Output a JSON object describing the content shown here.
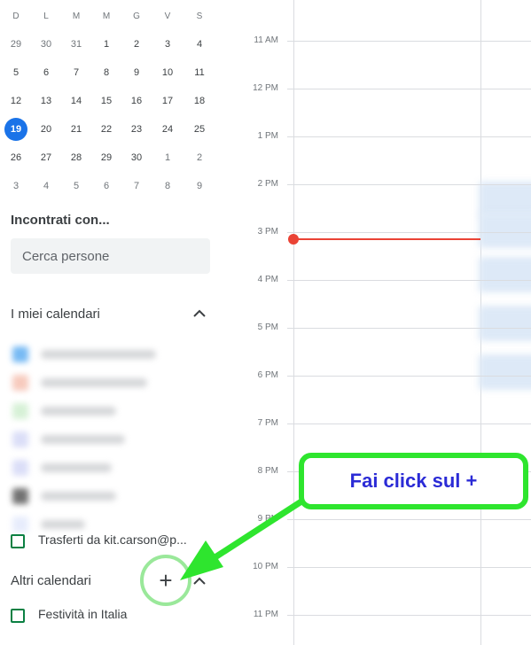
{
  "mini_calendar": {
    "weekdays": [
      "D",
      "L",
      "M",
      "M",
      "G",
      "V",
      "S"
    ],
    "weeks": [
      [
        {
          "d": "29",
          "m": true
        },
        {
          "d": "30",
          "m": true
        },
        {
          "d": "31",
          "m": true
        },
        {
          "d": "1"
        },
        {
          "d": "2"
        },
        {
          "d": "3"
        },
        {
          "d": "4"
        }
      ],
      [
        {
          "d": "5"
        },
        {
          "d": "6"
        },
        {
          "d": "7"
        },
        {
          "d": "8"
        },
        {
          "d": "9"
        },
        {
          "d": "10"
        },
        {
          "d": "11"
        }
      ],
      [
        {
          "d": "12"
        },
        {
          "d": "13"
        },
        {
          "d": "14"
        },
        {
          "d": "15"
        },
        {
          "d": "16"
        },
        {
          "d": "17"
        },
        {
          "d": "18"
        }
      ],
      [
        {
          "d": "19",
          "today": true
        },
        {
          "d": "20"
        },
        {
          "d": "21"
        },
        {
          "d": "22"
        },
        {
          "d": "23"
        },
        {
          "d": "24"
        },
        {
          "d": "25"
        }
      ],
      [
        {
          "d": "26"
        },
        {
          "d": "27"
        },
        {
          "d": "28"
        },
        {
          "d": "29"
        },
        {
          "d": "30"
        },
        {
          "d": "1",
          "m": true
        },
        {
          "d": "2",
          "m": true
        }
      ],
      [
        {
          "d": "3",
          "m": true
        },
        {
          "d": "4",
          "m": true
        },
        {
          "d": "5",
          "m": true
        },
        {
          "d": "6",
          "m": true
        },
        {
          "d": "7",
          "m": true
        },
        {
          "d": "8",
          "m": true
        },
        {
          "d": "9",
          "m": true
        }
      ]
    ],
    "today_color": "#1a73e8"
  },
  "meet_with": {
    "title": "Incontrati con...",
    "search_placeholder": "Cerca persone"
  },
  "my_calendars": {
    "title": "I miei calendari",
    "toggle_icon": "chevron-up-icon",
    "blurred_colors": [
      "#4aa3f0",
      "#f4b9a8",
      "#c9ecc9",
      "#cfd3f5",
      "#cfd3f5",
      "#444444",
      "#dfe6fb"
    ],
    "last_item_label": "Trasferti da kit.carson@p...",
    "last_item_color": "#0b8043"
  },
  "other_calendars": {
    "title": "Altri calendari",
    "add_label": "+",
    "toggle_icon": "chevron-up-icon",
    "items": [
      {
        "label": "Festività in Italia",
        "color": "#0b8043"
      }
    ]
  },
  "day_view": {
    "times": [
      "11 AM",
      "12 PM",
      "1 PM",
      "2 PM",
      "3 PM",
      "4 PM",
      "5 PM",
      "6 PM",
      "7 PM",
      "8 PM",
      "9 PM",
      "10 PM",
      "11 PM"
    ],
    "now_indicator_color": "#ea4335"
  },
  "callout": {
    "text": "Fai click sul +",
    "border_color": "#2ee52e",
    "text_color": "#2b2bd6"
  }
}
